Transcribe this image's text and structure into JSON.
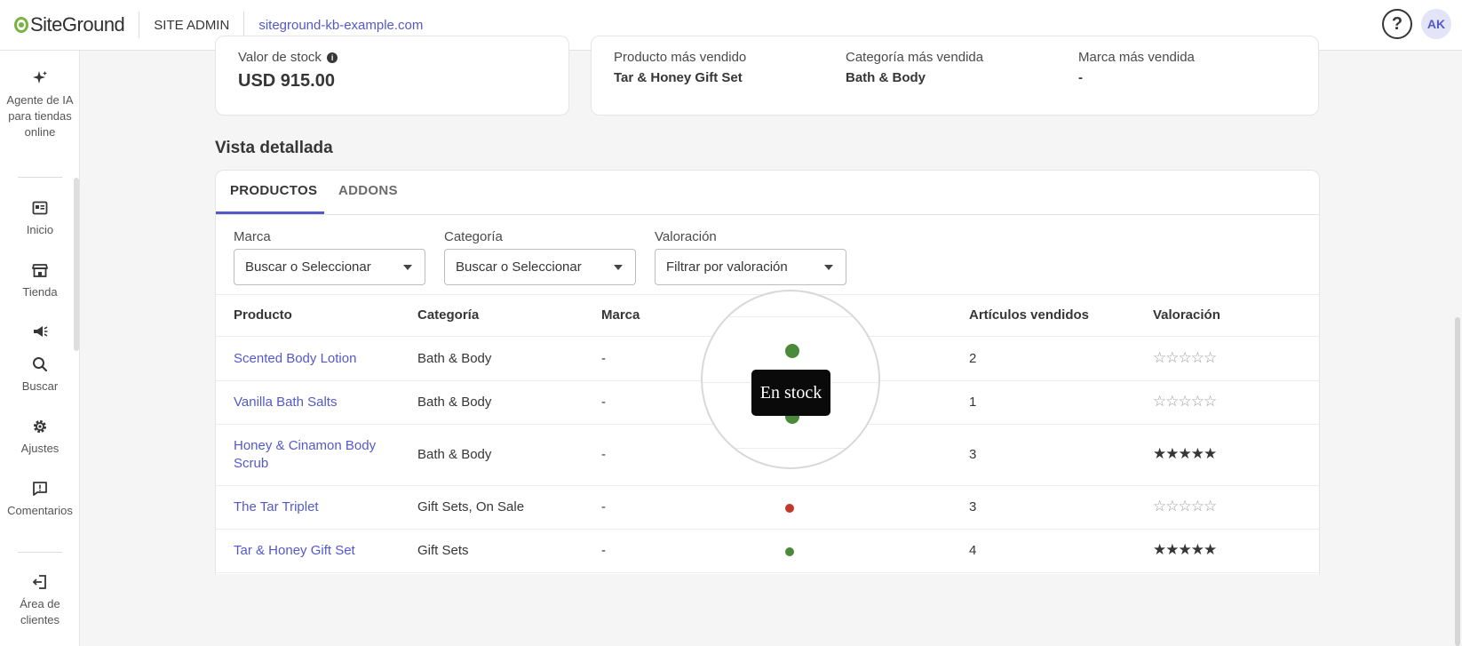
{
  "header": {
    "logo_text": "SiteGround",
    "section": "SITE ADMIN",
    "domain": "siteground-kb-example.com",
    "help_icon_glyph": "?",
    "avatar_initials": "AK"
  },
  "sidebar": {
    "items": [
      {
        "label": "Agente de IA para tiendas online",
        "icon": "sparkle-icon"
      },
      {
        "label": "Inicio",
        "icon": "dashboard-icon"
      },
      {
        "label": "Tienda",
        "icon": "store-icon"
      },
      {
        "label": "",
        "icon": "megaphone-icon"
      },
      {
        "label": "Buscar",
        "icon": "search-icon"
      },
      {
        "label": "Ajustes",
        "icon": "gear-icon"
      },
      {
        "label": "Comentarios",
        "icon": "feedback-icon"
      },
      {
        "label": "Área de clientes",
        "icon": "logout-icon"
      }
    ]
  },
  "stats": {
    "stock_value_label": "Valor de stock",
    "stock_value": "USD 915.00",
    "best_product_label": "Producto más vendido",
    "best_product": "Tar & Honey Gift Set",
    "best_category_label": "Categoría más vendida",
    "best_category": "Bath & Body",
    "best_brand_label": "Marca más vendida",
    "best_brand": "-"
  },
  "detail": {
    "title": "Vista detallada",
    "tabs": [
      {
        "label": "PRODUCTOS",
        "active": true
      },
      {
        "label": "ADDONS",
        "active": false
      }
    ],
    "filters": [
      {
        "label": "Marca",
        "value": "Buscar o Seleccionar"
      },
      {
        "label": "Categoría",
        "value": "Buscar o Seleccionar"
      },
      {
        "label": "Valoración",
        "value": "Filtrar por valoración"
      }
    ],
    "columns": [
      "Producto",
      "Categoría",
      "Marca",
      "",
      "Artículos vendidos",
      "Valoración"
    ],
    "rows": [
      {
        "product": "Scented Body Lotion",
        "category": "Bath & Body",
        "brand": "-",
        "stock": "in",
        "sold": "2",
        "rating": 0,
        "rating_text": "☆☆☆☆☆"
      },
      {
        "product": "Vanilla Bath Salts",
        "category": "Bath & Body",
        "brand": "-",
        "stock": "in",
        "sold": "1",
        "rating": 0,
        "rating_text": "☆☆☆☆☆"
      },
      {
        "product": "Honey & Cinamon Body Scrub",
        "category": "Bath & Body",
        "brand": "-",
        "stock": "in",
        "sold": "3",
        "rating": 5,
        "rating_text": "★★★★★"
      },
      {
        "product": "The Tar Triplet",
        "category": "Gift Sets, On Sale",
        "brand": "-",
        "stock": "out",
        "sold": "3",
        "rating": 0,
        "rating_text": "☆☆☆☆☆"
      },
      {
        "product": "Tar & Honey Gift Set",
        "category": "Gift Sets",
        "brand": "-",
        "stock": "in",
        "sold": "4",
        "rating": 5,
        "rating_text": "★★★★★"
      }
    ],
    "tooltip": "En stock"
  },
  "colors": {
    "accent": "#5459c9",
    "in_stock": "#4a8a3a",
    "out_of_stock": "#c0392b",
    "logo_green": "#7cb342"
  }
}
